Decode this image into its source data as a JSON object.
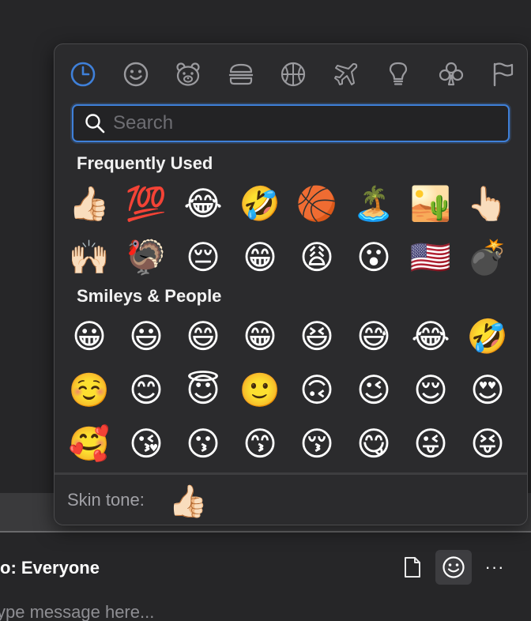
{
  "picker": {
    "categories": [
      {
        "name": "frequently-used",
        "icon": "clock-icon",
        "active": true
      },
      {
        "name": "smileys-people",
        "icon": "smiley-icon"
      },
      {
        "name": "animals-nature",
        "icon": "bear-icon"
      },
      {
        "name": "food-drink",
        "icon": "burger-icon"
      },
      {
        "name": "activity",
        "icon": "basketball-icon"
      },
      {
        "name": "travel-places",
        "icon": "airplane-icon"
      },
      {
        "name": "objects",
        "icon": "lightbulb-icon"
      },
      {
        "name": "symbols",
        "icon": "club-icon"
      },
      {
        "name": "flags",
        "icon": "flag-icon"
      }
    ],
    "accent_color": "#3f80d9",
    "search": {
      "placeholder": "Search",
      "value": ""
    },
    "sections": [
      {
        "title": "Frequently Used",
        "emojis": [
          "👍🏻",
          "💯",
          "😂",
          "🤣",
          "🏀",
          "🏝️",
          "🏜️",
          "👆🏻",
          "🙌🏻",
          "🦃",
          "😔",
          "😁",
          "😩",
          "😮",
          "🇺🇸",
          "💣"
        ]
      },
      {
        "title": "Smileys & People",
        "emojis": [
          "😀",
          "😃",
          "😄",
          "😁",
          "😆",
          "😅",
          "😂",
          "🤣",
          "☺️",
          "😊",
          "😇",
          "🙂",
          "🙃",
          "😉",
          "😌",
          "😍",
          "🥰",
          "😘",
          "😗",
          "😙",
          "😚",
          "😋",
          "😜",
          "😝"
        ]
      }
    ],
    "skin_tone": {
      "label": "Skin tone:",
      "emoji": "👍🏻"
    }
  },
  "chat": {
    "to_label": "o: Everyone",
    "message_placeholder": "ype message here...",
    "more_label": "···"
  }
}
